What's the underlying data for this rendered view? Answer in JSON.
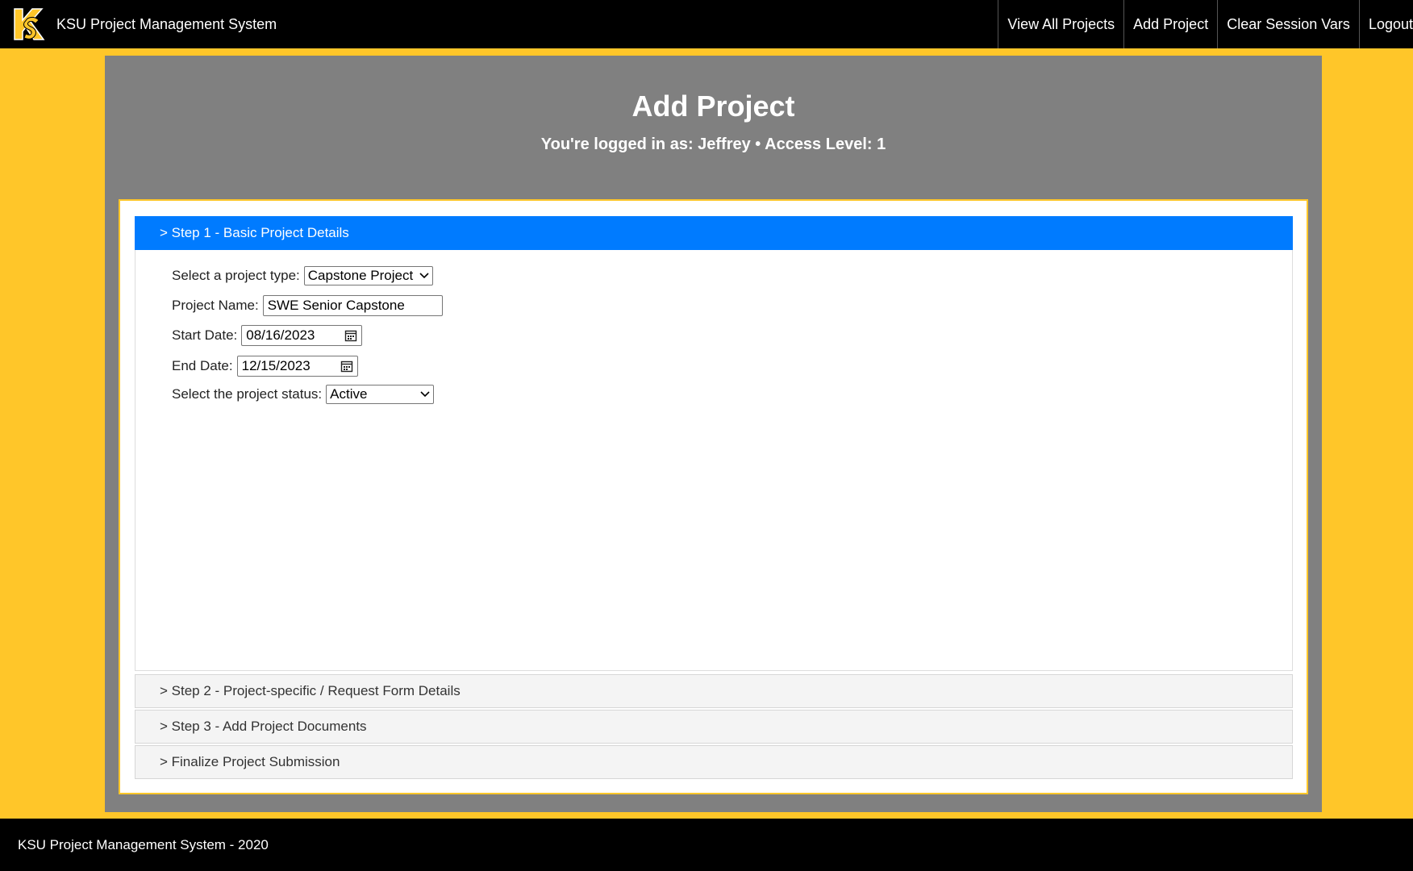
{
  "header": {
    "brand": "KSU Project Management System",
    "logo_icon": "ksu-logo-icon",
    "nav": [
      {
        "label": "View All Projects"
      },
      {
        "label": "Add Project"
      },
      {
        "label": "Clear Session Vars"
      },
      {
        "label": "Logout"
      }
    ]
  },
  "main": {
    "title": "Add Project",
    "login_info": "You're logged in as: Jeffrey • Access Level: 1"
  },
  "steps": {
    "step1": {
      "label": "> Step 1 - Basic Project Details",
      "fields": {
        "project_type_label": "Select a project type:",
        "project_type_value": "Capstone Project",
        "project_name_label": "Project Name:",
        "project_name_value": "SWE Senior Capstone",
        "start_date_label": "Start Date:",
        "start_date_value": "08/16/2023",
        "end_date_label": "End Date:",
        "end_date_value": "12/15/2023",
        "status_label": "Select the project status:",
        "status_value": "Active"
      }
    },
    "step2": {
      "label": "> Step 2 - Project-specific / Request Form Details"
    },
    "step3": {
      "label": "> Step 3 - Add Project Documents"
    },
    "step4": {
      "label": "> Finalize Project Submission"
    }
  },
  "footer": {
    "text": "KSU Project Management System - 2020"
  },
  "colors": {
    "accent_gold": "#FFC629",
    "active_step": "#007BFF",
    "panel_grey": "#808080",
    "bar_black": "#000000"
  }
}
